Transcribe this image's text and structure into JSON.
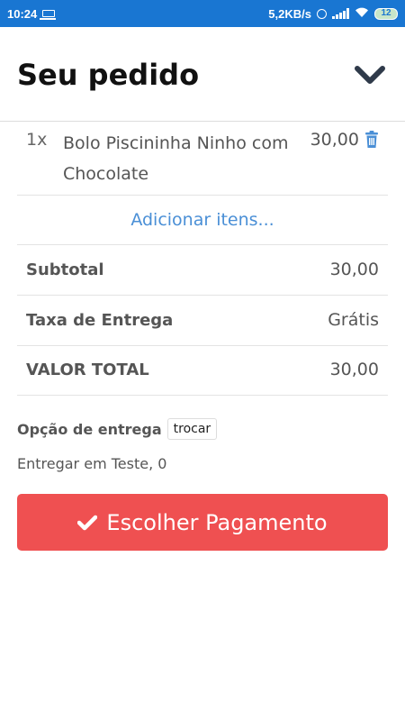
{
  "status_bar": {
    "time": "10:24",
    "network_speed": "5,2KB/s",
    "battery": "12",
    "icons": [
      "laptop-icon",
      "alarm-icon",
      "signal-icon",
      "wifi-icon",
      "battery-icon"
    ]
  },
  "header": {
    "title": "Seu pedido",
    "collapse_icon": "chevron-down-icon"
  },
  "cart": {
    "items": [
      {
        "qty": "1x",
        "name": "Bolo Piscininha Ninho com Chocolate",
        "price": "30,00",
        "delete_icon": "trash-icon"
      }
    ],
    "add_items_link": "Adicionar itens..."
  },
  "summary": {
    "subtotal_label": "Subtotal",
    "subtotal_value": "30,00",
    "delivery_fee_label": "Taxa de Entrega",
    "delivery_fee_value": "Grátis",
    "total_label": "VALOR TOTAL",
    "total_value": "30,00"
  },
  "delivery": {
    "option_label": "Opção de entrega",
    "change_button": "trocar",
    "address": "Entregar em Teste, 0"
  },
  "payment_button": {
    "label": "Escolher Pagamento",
    "icon": "check-icon"
  },
  "colors": {
    "status_bar": "#1976d2",
    "accent_link": "#4a8fd6",
    "payment_button": "#ef5051",
    "title": "#111111"
  }
}
